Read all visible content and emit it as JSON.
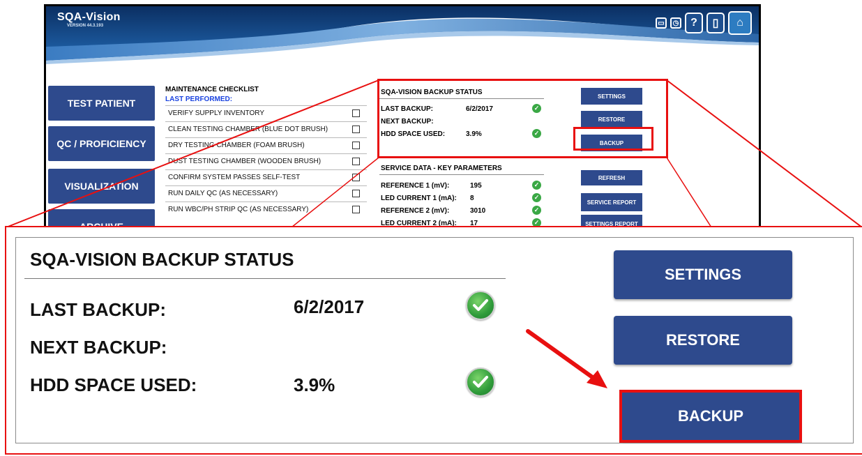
{
  "header": {
    "brand": "SQA-Vision",
    "version": "VERSION 44.3.193",
    "icons": [
      "minimize-icon",
      "clock-icon",
      "help-icon",
      "exit-door-icon",
      "home-icon"
    ],
    "help_glyph": "?"
  },
  "nav": {
    "items": [
      {
        "label": "TEST PATIENT"
      },
      {
        "label": "QC / PROFICIENCY"
      },
      {
        "label": "VISUALIZATION"
      },
      {
        "label": "ARCHIVE"
      }
    ]
  },
  "checklist": {
    "title": "MAINTENANCE CHECKLIST",
    "last_performed": "LAST PERFORMED:",
    "items": [
      {
        "label": "VERIFY SUPPLY INVENTORY",
        "checked": false
      },
      {
        "label": "CLEAN TESTING CHAMBER (BLUE DOT BRUSH)",
        "checked": false
      },
      {
        "label": "DRY TESTING CHAMBER (FOAM BRUSH)",
        "checked": false
      },
      {
        "label": "DUST TESTING CHAMBER (WOODEN BRUSH)",
        "checked": false
      },
      {
        "label": "CONFIRM SYSTEM PASSES SELF-TEST",
        "checked": false
      },
      {
        "label": "RUN DAILY QC (AS NECESSARY)",
        "checked": false
      },
      {
        "label": "RUN WBC/PH STRIP QC (AS NECESSARY)",
        "checked": false
      }
    ]
  },
  "backup_status": {
    "title": "SQA-VISION BACKUP STATUS",
    "last_backup_label": "LAST BACKUP:",
    "last_backup_value": "6/2/2017",
    "next_backup_label": "NEXT BACKUP:",
    "hdd_label": "HDD SPACE USED:",
    "hdd_value": "3.9%",
    "settings_label": "SETTINGS",
    "restore_label": "RESTORE",
    "backup_label": "BACKUP"
  },
  "service_data": {
    "title": "SERVICE DATA -  KEY PARAMETERS",
    "rows": [
      {
        "label": "REFERENCE 1 (mV):",
        "value": "195"
      },
      {
        "label": "LED CURRENT 1 (mA):",
        "value": "8"
      },
      {
        "label": "REFERENCE 2 (mV):",
        "value": "3010"
      },
      {
        "label": "LED CURRENT 2 (mA):",
        "value": "17"
      }
    ],
    "refresh_label": "REFRESH",
    "service_report_label": "SERVICE REPORT",
    "settings_report_label": "SETTINGS REPORT"
  },
  "colors": {
    "button_blue": "#2e4a8d",
    "highlight_red": "#e81010",
    "check_green": "#3aa845",
    "link_blue": "#1a43e0"
  }
}
